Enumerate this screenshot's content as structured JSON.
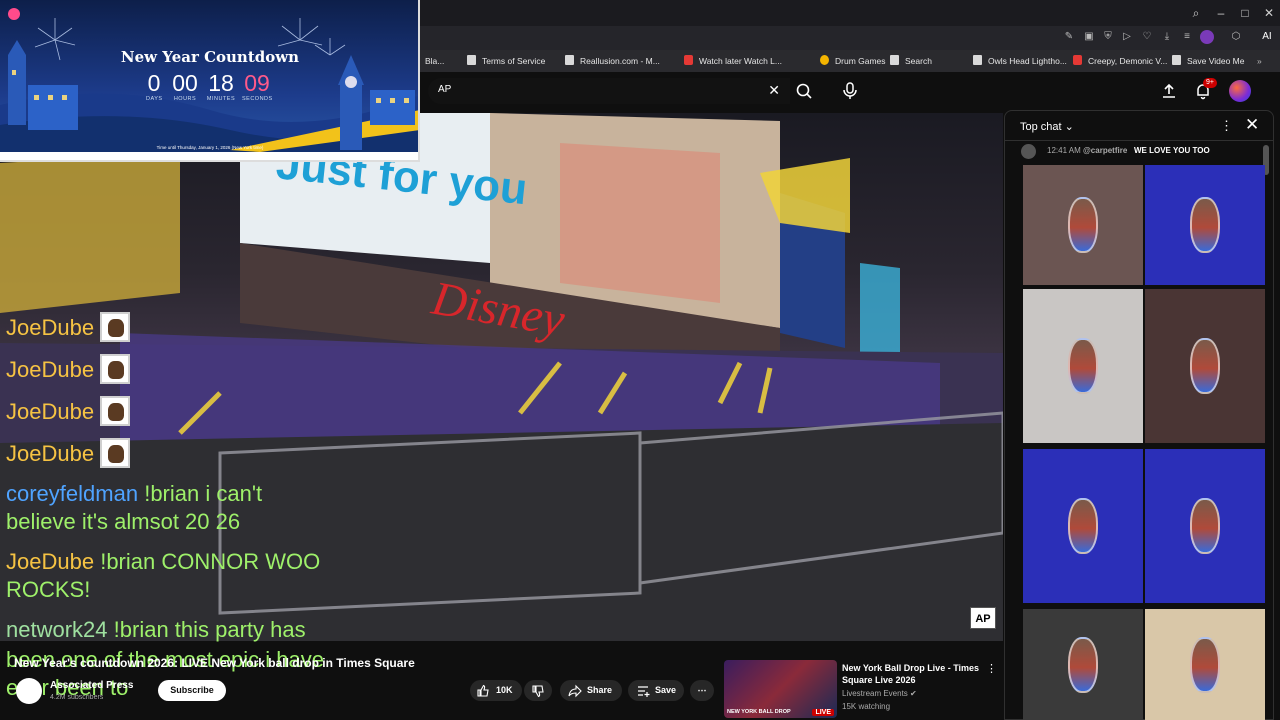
{
  "bookmarks": [
    {
      "label": "Bla...",
      "fav": "page"
    },
    {
      "label": "Terms of Service",
      "fav": "page"
    },
    {
      "label": "Reallusion.com - M...",
      "fav": "page"
    },
    {
      "label": "Watch later Watch L...",
      "fav": "youtube"
    },
    {
      "label": "Drum Games",
      "fav": "circle"
    },
    {
      "label": "Search",
      "fav": "page"
    },
    {
      "label": "Owls Head Lightho...",
      "fav": "page"
    },
    {
      "label": "Creepy, Demonic V...",
      "fav": "youtube"
    },
    {
      "label": "Save Video Me",
      "fav": "page"
    }
  ],
  "tabbar": {
    "ai_label": "AI"
  },
  "search": {
    "query": "AP"
  },
  "notifications": {
    "badge": "9+"
  },
  "countdown": {
    "title": "New Year Countdown",
    "units": [
      {
        "value": "0",
        "label": "DAYS"
      },
      {
        "value": "00",
        "label": "HOURS"
      },
      {
        "value": "18",
        "label": "MINUTES"
      },
      {
        "value": "09",
        "label": "SECONDS"
      }
    ],
    "footer": "Time until Thursday, January 1, 2026 (New York time)"
  },
  "overlay_chat": [
    {
      "name": "JoeDube",
      "message": "",
      "badge": true
    },
    {
      "name": "JoeDube",
      "message": "",
      "badge": true
    },
    {
      "name": "JoeDube",
      "message": "",
      "badge": true
    },
    {
      "name": "JoeDube",
      "message": "",
      "badge": true
    },
    {
      "name": "coreyfeldman",
      "message": "!brian i can't",
      "cont": "believe it's almsot 20 26"
    },
    {
      "name": "JoeDube",
      "message": "!brian CONNOR WOO",
      "cont": "ROCKS!"
    },
    {
      "name": "network24",
      "message": "!brian this party has",
      "cont": "been one of the most epic i have",
      "cont2": "ever been to"
    }
  ],
  "video": {
    "title": "New Year's countdown 2026: LIVE New York ball drop in Times Square",
    "watermark": "AP",
    "channel": "Associated Press",
    "subscribers": "4.2M subscribers",
    "subscribe_label": "Subscribe",
    "likes": "10K",
    "share_label": "Share",
    "save_label": "Save"
  },
  "recommendation": {
    "title": "New York Ball Drop Live - Times Square Live 2026",
    "channel": "Livestream Events",
    "watching": "15K watching",
    "live_label": "LIVE",
    "thumb_tag": "NEW YORK BALL DROP"
  },
  "chat": {
    "title": "Top chat",
    "message": {
      "time": "12:41 AM",
      "author": "@carpetfire",
      "text": "WE LOVE YOU TOO"
    },
    "tiles": [
      {
        "bg": "#6b5552"
      },
      {
        "bg": "#2b2fb8"
      },
      {
        "bg": "#c9c6c4"
      },
      {
        "bg": "#4a3534"
      },
      {
        "bg": "#2b2fb8"
      },
      {
        "bg": "#2b2fb8"
      },
      {
        "bg": "#3a3a3a"
      },
      {
        "bg": "#d9c7a8"
      }
    ]
  }
}
